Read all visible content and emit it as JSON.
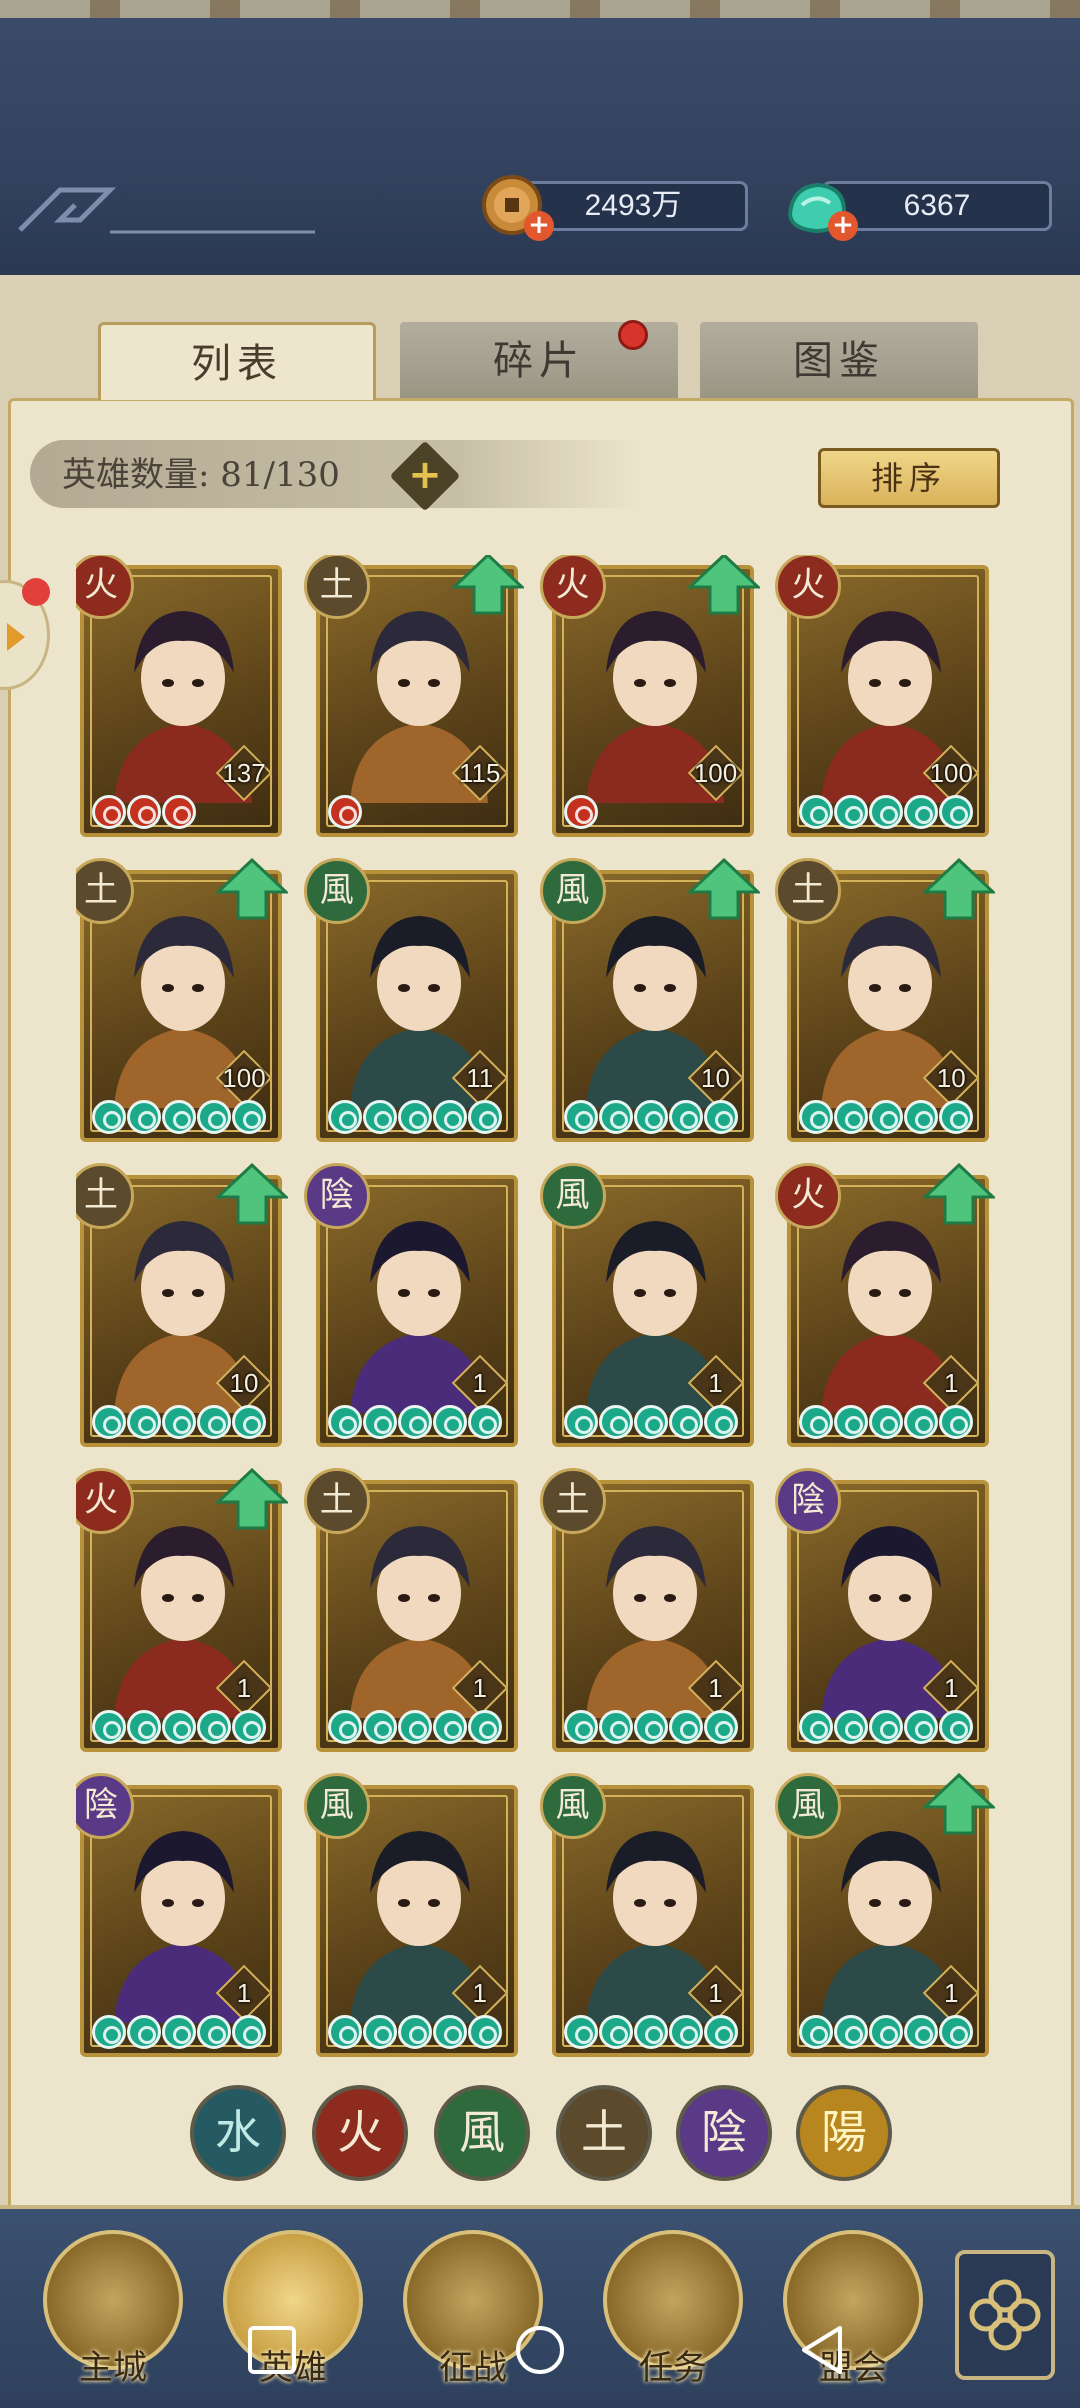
{
  "resources": {
    "coin": {
      "value": "2493万",
      "icon": "copper-coin-icon"
    },
    "jade": {
      "value": "6367",
      "icon": "jade-icon"
    }
  },
  "tabs": [
    {
      "label": "列表",
      "active": true
    },
    {
      "label": "碎片",
      "active": false,
      "badge": true
    },
    {
      "label": "图鉴",
      "active": false
    }
  ],
  "hero_count": {
    "label": "英雄数量: 81/130"
  },
  "sort_label": "排序",
  "elements": {
    "fire": "火",
    "earth": "土",
    "wind": "風",
    "yin": "陰",
    "yang": "陽",
    "water": "水"
  },
  "heroes": [
    {
      "element": "fire",
      "level": "137",
      "stars": 3,
      "star_color": "red",
      "upgrade": false
    },
    {
      "element": "earth",
      "level": "115",
      "stars": 1,
      "star_color": "red",
      "upgrade": true
    },
    {
      "element": "fire",
      "level": "100",
      "stars": 1,
      "star_color": "red",
      "upgrade": true
    },
    {
      "element": "fire",
      "level": "100",
      "stars": 5,
      "star_color": "jade",
      "upgrade": false
    },
    {
      "element": "earth",
      "level": "100",
      "stars": 5,
      "star_color": "jade",
      "upgrade": true
    },
    {
      "element": "wind",
      "level": "11",
      "stars": 5,
      "star_color": "jade",
      "upgrade": false
    },
    {
      "element": "wind",
      "level": "10",
      "stars": 5,
      "star_color": "jade",
      "upgrade": true
    },
    {
      "element": "earth",
      "level": "10",
      "stars": 5,
      "star_color": "jade",
      "upgrade": true
    },
    {
      "element": "earth",
      "level": "10",
      "stars": 5,
      "star_color": "jade",
      "upgrade": true
    },
    {
      "element": "yin",
      "level": "1",
      "stars": 5,
      "star_color": "jade",
      "upgrade": false
    },
    {
      "element": "wind",
      "level": "1",
      "stars": 5,
      "star_color": "jade",
      "upgrade": false
    },
    {
      "element": "fire",
      "level": "1",
      "stars": 5,
      "star_color": "jade",
      "upgrade": true
    },
    {
      "element": "fire",
      "level": "1",
      "stars": 5,
      "star_color": "jade",
      "upgrade": true
    },
    {
      "element": "earth",
      "level": "1",
      "stars": 5,
      "star_color": "jade",
      "upgrade": false
    },
    {
      "element": "earth",
      "level": "1",
      "stars": 5,
      "star_color": "jade",
      "upgrade": false
    },
    {
      "element": "yin",
      "level": "1",
      "stars": 5,
      "star_color": "jade",
      "upgrade": false
    },
    {
      "element": "yin",
      "level": "1",
      "stars": 5,
      "star_color": "jade",
      "upgrade": false
    },
    {
      "element": "wind",
      "level": "1",
      "stars": 5,
      "star_color": "jade",
      "upgrade": false
    },
    {
      "element": "wind",
      "level": "1",
      "stars": 5,
      "star_color": "jade",
      "upgrade": false
    },
    {
      "element": "wind",
      "level": "1",
      "stars": 5,
      "star_color": "jade",
      "upgrade": true
    }
  ],
  "filters": [
    {
      "key": "water",
      "label": "水"
    },
    {
      "key": "fire",
      "label": "火"
    },
    {
      "key": "wind",
      "label": "風"
    },
    {
      "key": "earth",
      "label": "土"
    },
    {
      "key": "yin",
      "label": "陰"
    },
    {
      "key": "yang",
      "label": "陽"
    }
  ],
  "nav": [
    {
      "label": "主城",
      "icon": "city-icon"
    },
    {
      "label": "英雄",
      "icon": "hero-icon",
      "active": true
    },
    {
      "label": "征战",
      "icon": "battle-icon"
    },
    {
      "label": "任务",
      "icon": "task-icon"
    },
    {
      "label": "盟会",
      "icon": "guild-icon"
    }
  ]
}
